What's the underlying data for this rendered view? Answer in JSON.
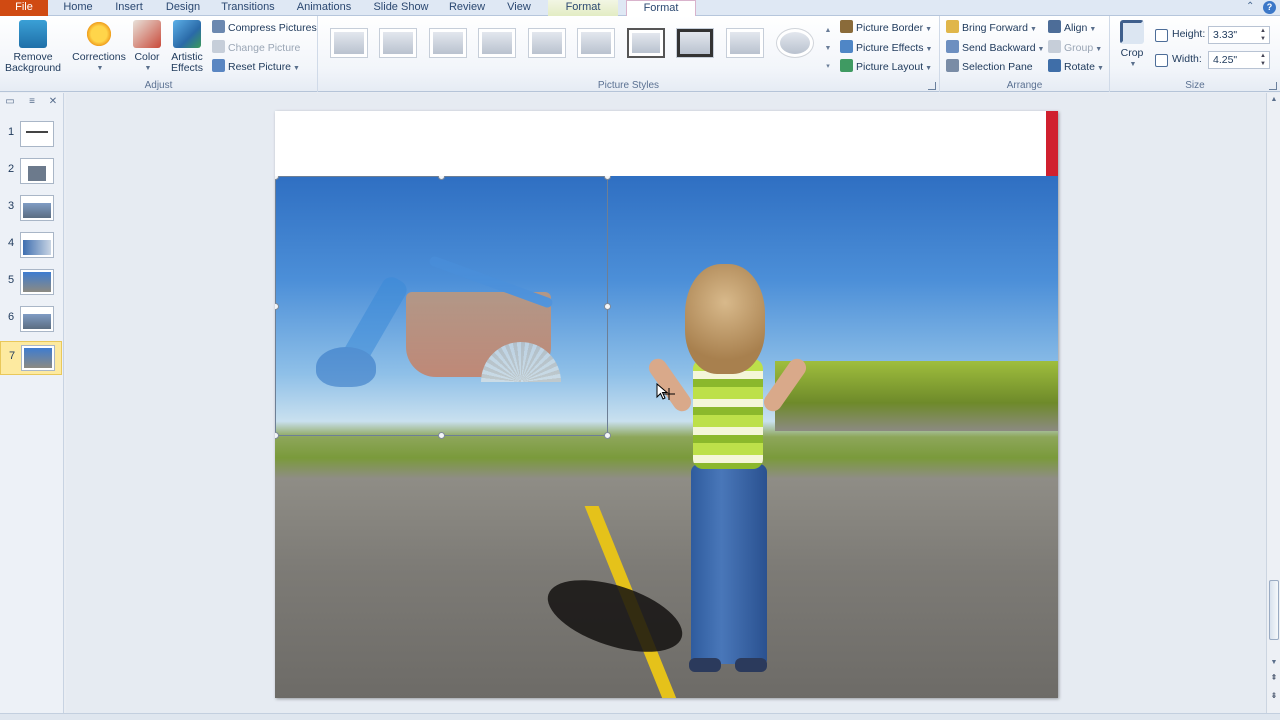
{
  "tabs": {
    "file": "File",
    "home": "Home",
    "insert": "Insert",
    "design": "Design",
    "transitions": "Transitions",
    "animations": "Animations",
    "slideshow": "Slide Show",
    "review": "Review",
    "view": "View",
    "format_contextual": "Format",
    "format_active": "Format"
  },
  "ribbon": {
    "adjust": {
      "label": "Adjust",
      "remove_background": "Remove Background",
      "corrections": "Corrections",
      "color": "Color",
      "artistic_effects": "Artistic Effects",
      "compress_pictures": "Compress Pictures",
      "change_picture": "Change Picture",
      "reset_picture": "Reset Picture"
    },
    "picture_styles": {
      "label": "Picture Styles",
      "picture_border": "Picture Border",
      "picture_effects": "Picture Effects",
      "picture_layout": "Picture Layout"
    },
    "arrange": {
      "label": "Arrange",
      "bring_forward": "Bring Forward",
      "send_backward": "Send Backward",
      "selection_pane": "Selection Pane",
      "align": "Align",
      "group": "Group",
      "rotate": "Rotate"
    },
    "size": {
      "label": "Size",
      "crop": "Crop",
      "height_label": "Height:",
      "height_value": "3.33\"",
      "width_label": "Width:",
      "width_value": "4.25\""
    }
  },
  "slides": [
    {
      "num": "1"
    },
    {
      "num": "2"
    },
    {
      "num": "3"
    },
    {
      "num": "4"
    },
    {
      "num": "5"
    },
    {
      "num": "6"
    },
    {
      "num": "7"
    }
  ],
  "colors": {
    "file_tab": "#d04a12",
    "accent_bar": "#d0202e",
    "active_slide": "#fdeaa0"
  }
}
